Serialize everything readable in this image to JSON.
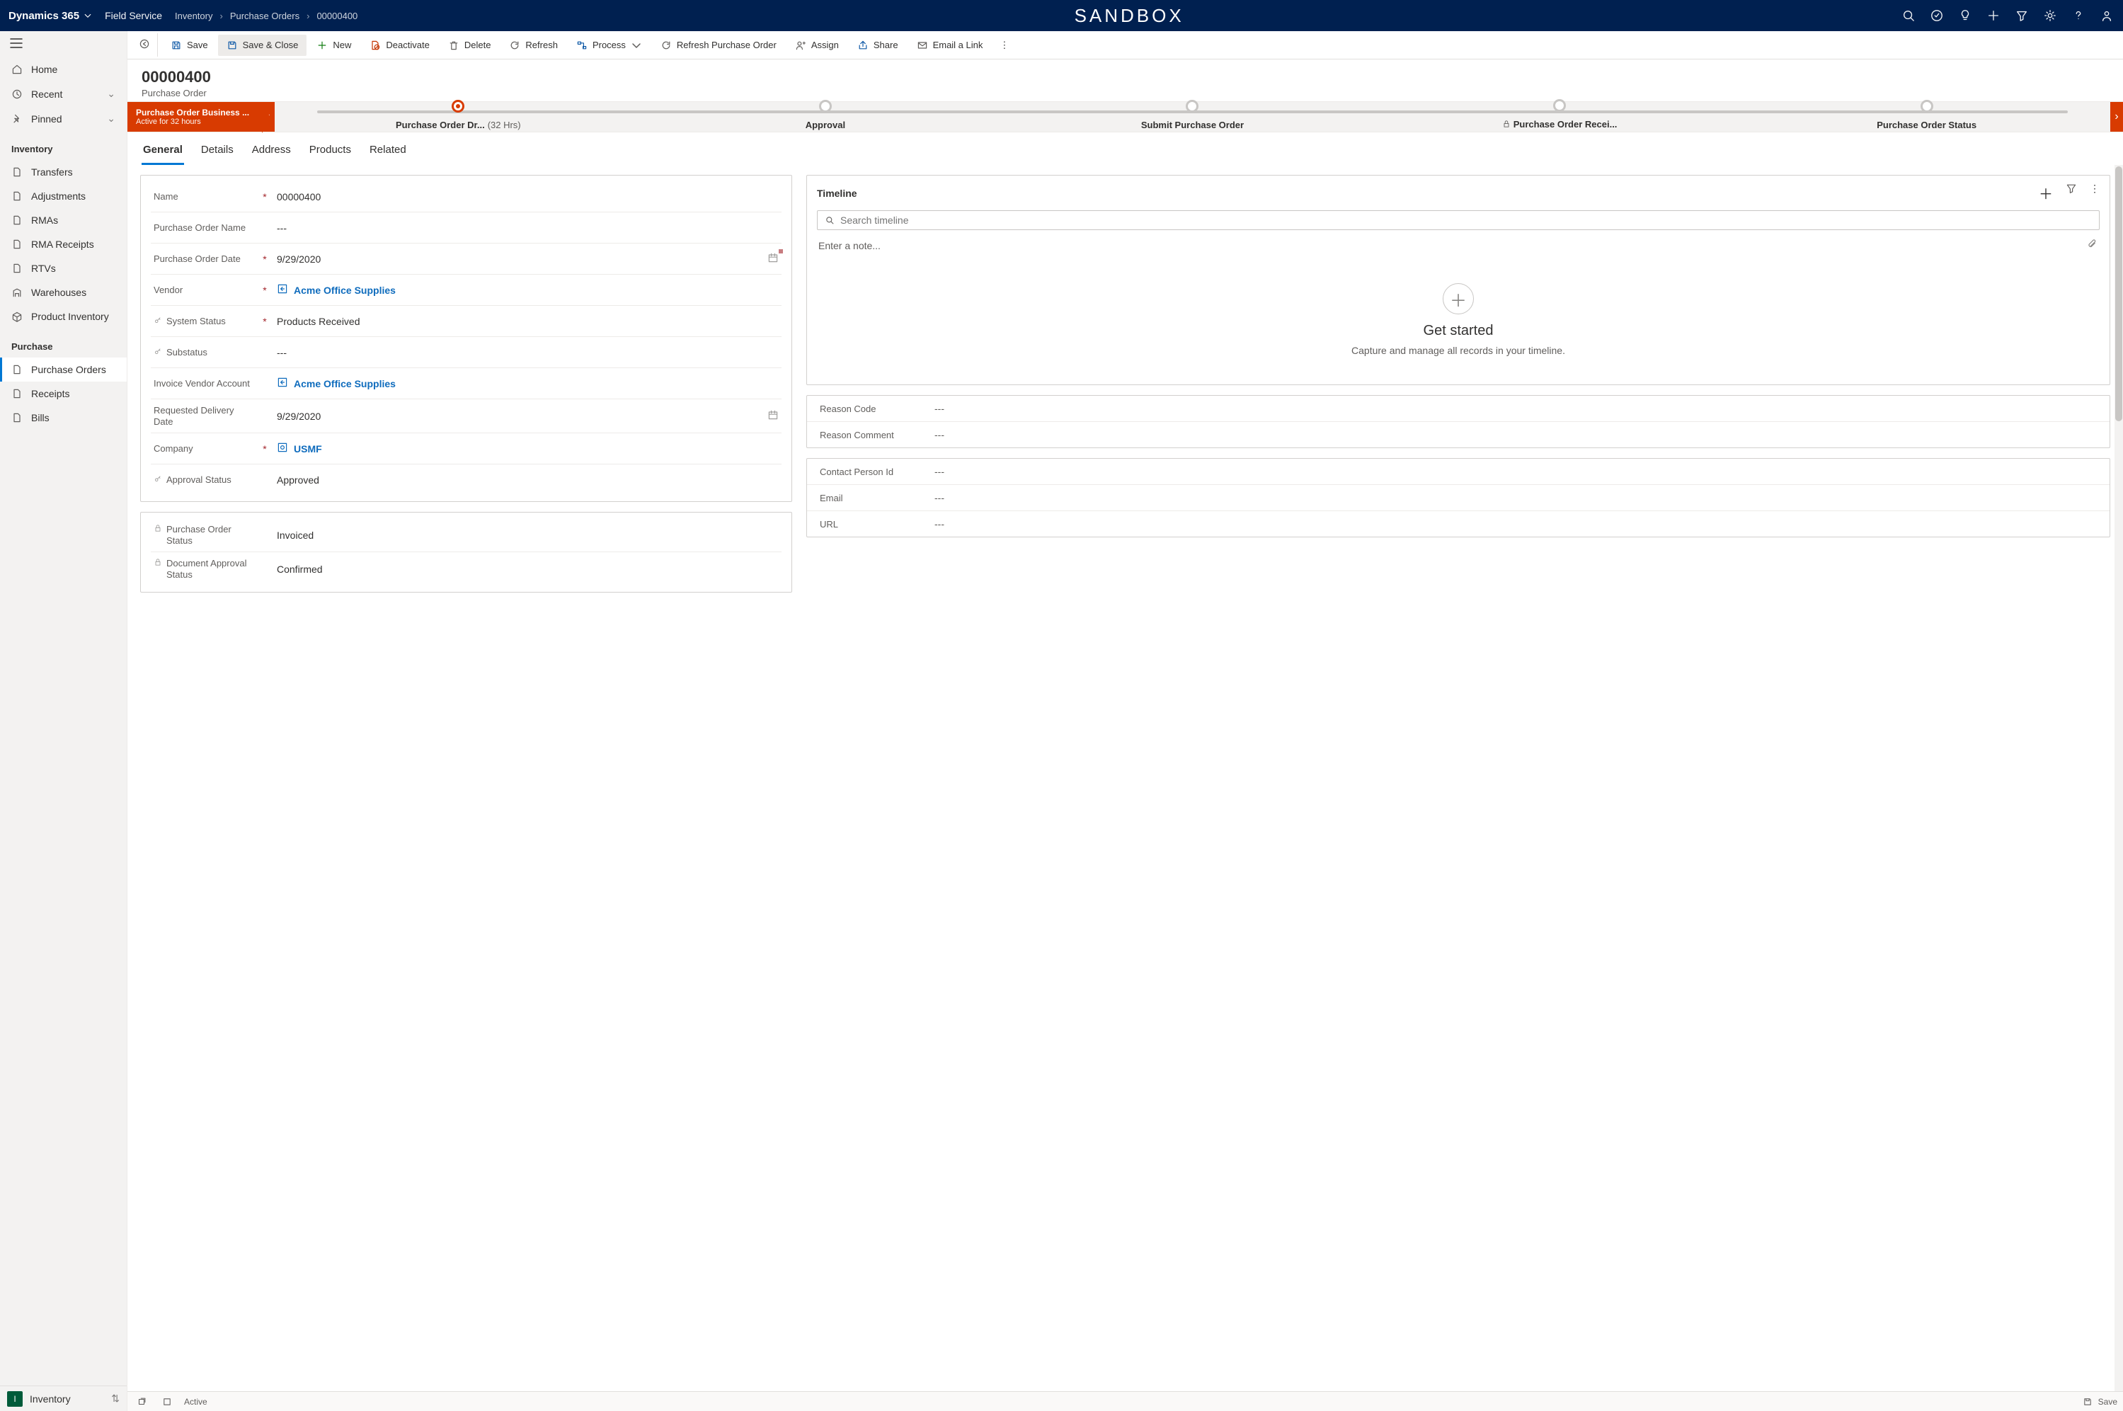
{
  "topbar": {
    "app": "Dynamics 365",
    "module": "Field Service",
    "breadcrumbs": [
      "Inventory",
      "Purchase Orders",
      "00000400"
    ],
    "center": "SANDBOX"
  },
  "leftnav": {
    "home": "Home",
    "recent": "Recent",
    "pinned": "Pinned",
    "groups": [
      {
        "label": "Inventory",
        "items": [
          "Transfers",
          "Adjustments",
          "RMAs",
          "RMA Receipts",
          "RTVs",
          "Warehouses",
          "Product Inventory"
        ]
      },
      {
        "label": "Purchase",
        "items": [
          "Purchase Orders",
          "Receipts",
          "Bills"
        ],
        "selectedIndex": 0
      }
    ],
    "appSwitcher": {
      "badge": "I",
      "label": "Inventory"
    }
  },
  "commands": {
    "save": "Save",
    "saveClose": "Save & Close",
    "newRec": "New",
    "deactivate": "Deactivate",
    "delete": "Delete",
    "refresh": "Refresh",
    "process": "Process",
    "refreshPO": "Refresh Purchase Order",
    "assign": "Assign",
    "share": "Share",
    "emailLink": "Email a Link"
  },
  "record": {
    "number": "00000400",
    "type": "Purchase Order"
  },
  "bpf": {
    "title": "Purchase Order Business ...",
    "subtitle": "Active for 32 hours",
    "stages": [
      {
        "label": "Purchase Order Dr...",
        "duration": "(32 Hrs)",
        "active": true
      },
      {
        "label": "Approval"
      },
      {
        "label": "Submit Purchase Order"
      },
      {
        "label": "Purchase Order Recei...",
        "locked": true
      },
      {
        "label": "Purchase Order Status"
      }
    ]
  },
  "tabs": [
    "General",
    "Details",
    "Address",
    "Products",
    "Related"
  ],
  "activeTab": "General",
  "fields": {
    "name": {
      "label": "Name",
      "required": true,
      "value": "00000400"
    },
    "poName": {
      "label": "Purchase Order Name",
      "value": "---"
    },
    "poDate": {
      "label": "Purchase Order Date",
      "required": true,
      "value": "9/29/2020"
    },
    "vendor": {
      "label": "Vendor",
      "required": true,
      "value": "Acme Office Supplies",
      "lookup": true
    },
    "systemStatus": {
      "label": "System Status",
      "required": true,
      "key": true,
      "value": "Products Received"
    },
    "substatus": {
      "label": "Substatus",
      "key": true,
      "value": "---"
    },
    "invoiceVendor": {
      "label": "Invoice Vendor Account",
      "value": "Acme Office Supplies",
      "lookup": true
    },
    "reqDelivery": {
      "label": "Requested Delivery Date",
      "value": "9/29/2020"
    },
    "company": {
      "label": "Company",
      "required": true,
      "value": "USMF",
      "lookup": true
    },
    "approvalStatus": {
      "label": "Approval Status",
      "key": true,
      "value": "Approved"
    },
    "poStatus": {
      "label": "Purchase Order Status",
      "locked": true,
      "value": "Invoiced"
    },
    "docApproval": {
      "label": "Document Approval Status",
      "locked": true,
      "value": "Confirmed"
    },
    "reasonCode": {
      "label": "Reason Code",
      "value": "---"
    },
    "reasonComment": {
      "label": "Reason Comment",
      "value": "---"
    },
    "contactPerson": {
      "label": "Contact Person Id",
      "value": "---"
    },
    "email": {
      "label": "Email",
      "value": "---"
    },
    "url": {
      "label": "URL",
      "value": "---"
    }
  },
  "timeline": {
    "title": "Timeline",
    "searchPlaceholder": "Search timeline",
    "notePlaceholder": "Enter a note...",
    "emptyTitle": "Get started",
    "emptySub": "Capture and manage all records in your timeline."
  },
  "statusbar": {
    "status": "Active",
    "save": "Save"
  }
}
